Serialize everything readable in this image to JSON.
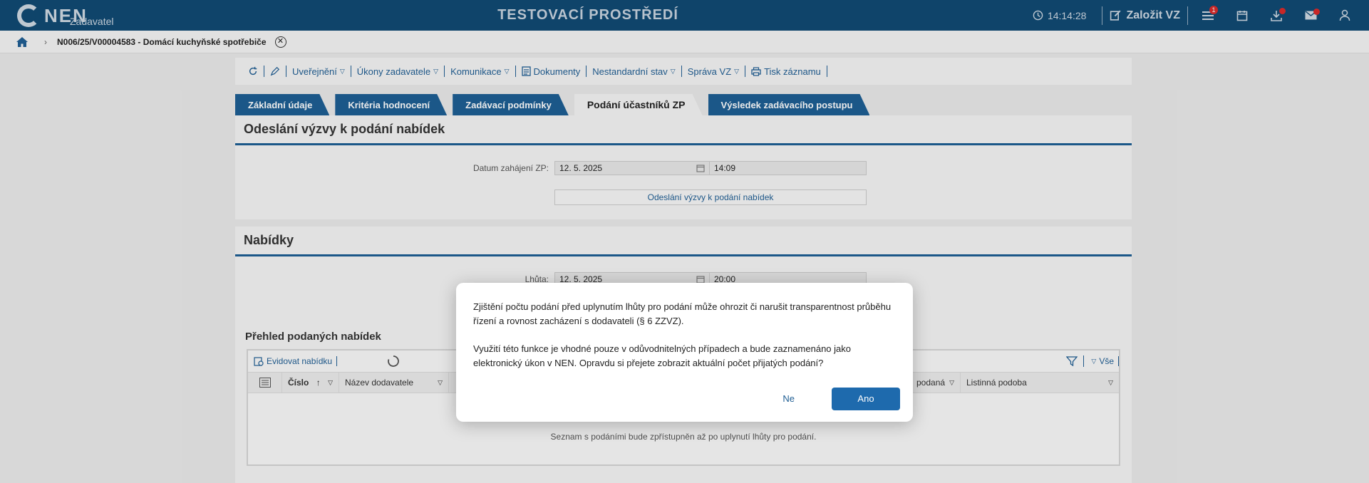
{
  "header": {
    "logo": "NEN",
    "logo_sub": "Zadavatel",
    "env_title": "TESTOVACÍ PROSTŘEDÍ",
    "time": "14:14:28",
    "create_label": "Založit VZ",
    "menu_badge": "1"
  },
  "breadcrumb": {
    "item": "N006/25/V00004583 - Domácí kuchyňské spotřebiče"
  },
  "toolbar": {
    "items": [
      "Uveřejnění",
      "Úkony zadavatele",
      "Komunikace",
      "Dokumenty",
      "Nestandardní stav",
      "Správa VZ",
      "Tisk záznamu"
    ]
  },
  "tabs": [
    "Základní údaje",
    "Kritéria hodnocení",
    "Zadávací podmínky",
    "Podání účastníků ZP",
    "Výsledek zadávacího postupu"
  ],
  "section1": {
    "title": "Odeslání výzvy k podání nabídek",
    "date_label": "Datum zahájení ZP:",
    "date": "12. 5. 2025",
    "time": "14:09",
    "button": "Odeslání výzvy k podání nabídek"
  },
  "section2": {
    "title": "Nabídky",
    "deadline_label": "Lhůta:",
    "date": "12. 5. 2025",
    "time": "20:00",
    "overview_title": "Přehled podaných nabídek",
    "register_button": "Evidovat nabídku",
    "filter_all": "Vše",
    "columns": [
      "Číslo",
      "Název dodavatele",
      "podaná",
      "Listinná podoba"
    ],
    "empty_message": "Seznam s podáními bude zpřístupněn až po uplynutí lhůty pro podání."
  },
  "dialog": {
    "text1": "Zjištění počtu podání před uplynutím lhůty pro podání může ohrozit či narušit transparentnost průběhu řízení a rovnost zacházení s dodavateli (§ 6 ZZVZ).",
    "text2": "Využití této funkce je vhodné pouze v odůvodnitelných případech a bude zaznamenáno jako elektronický úkon v NEN. Opravdu si přejete zobrazit aktuální počet přijatých podání?",
    "no": "Ne",
    "yes": "Ano"
  }
}
